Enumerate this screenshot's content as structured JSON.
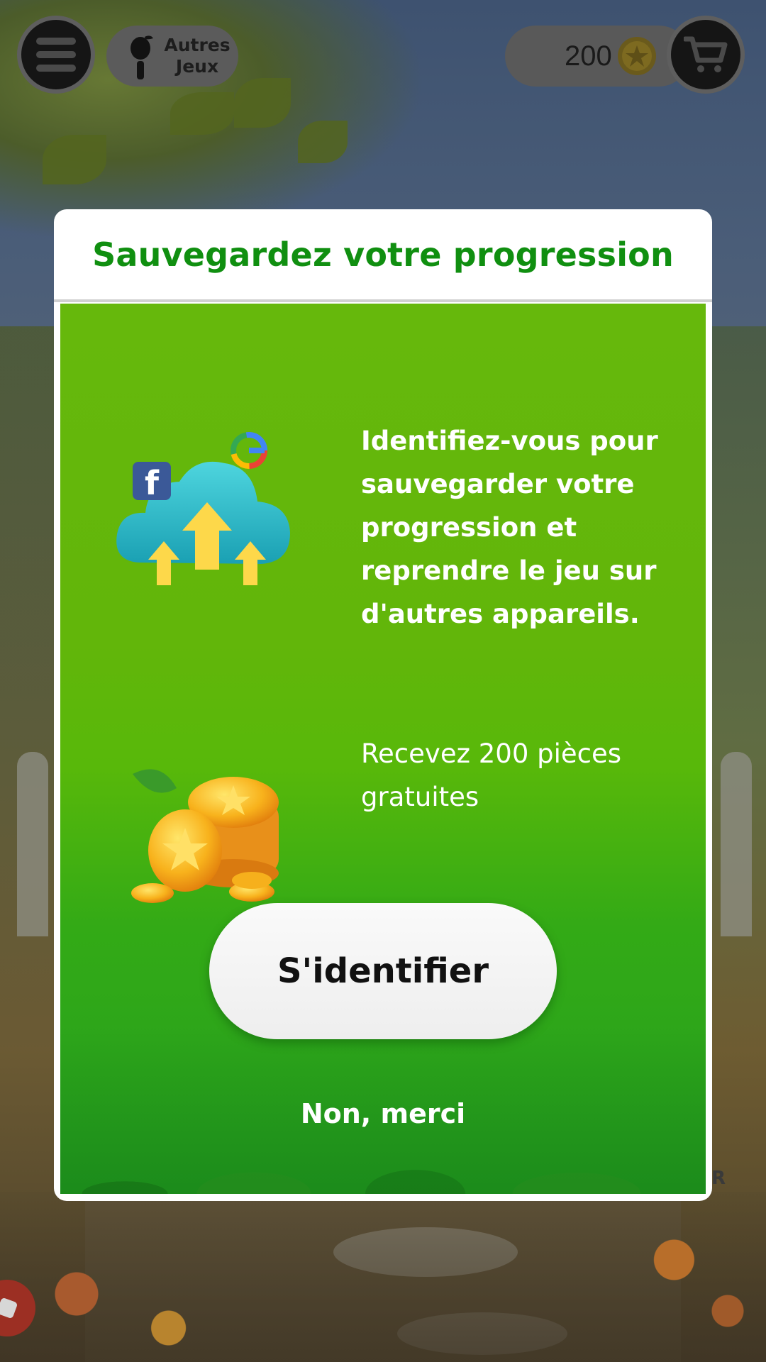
{
  "header": {
    "other_games_label": "Autres Jeux",
    "coin_count": "200"
  },
  "icons": {
    "menu": "hamburger-menu-icon",
    "other_games": "apple-icon",
    "coin": "coin-icon",
    "cart": "shopping-cart-icon"
  },
  "modal": {
    "title": "Sauvegardez votre progression",
    "feature_login_text": "Identifiez-vous pour sauvegarder votre progression et reprendre le jeu sur d'autres appareils.",
    "feature_coins_text": "Recevez 200 pièces gratuites",
    "login_button_label": "S'identifier",
    "dismiss_label": "Non, merci"
  },
  "background": {
    "corner_letter": "R"
  },
  "colors": {
    "title_green": "#108f10",
    "panel_green": "#62b60a",
    "button_white": "#f2f2f2"
  }
}
